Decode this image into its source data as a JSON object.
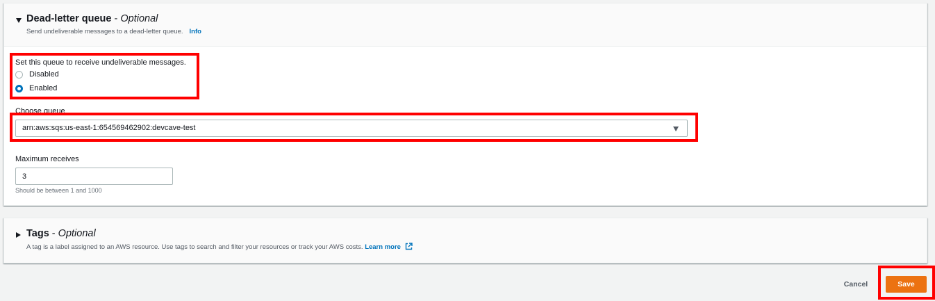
{
  "dlq_section": {
    "title": "Dead-letter queue",
    "separator": " - ",
    "optional": "Optional",
    "description": "Send undeliverable messages to a dead-letter queue.",
    "info_link": "Info",
    "receive_label": "Set this queue to receive undeliverable messages.",
    "options": [
      {
        "label": "Disabled",
        "checked": false
      },
      {
        "label": "Enabled",
        "checked": true
      }
    ],
    "choose_queue_label": "Choose queue",
    "queue_value": "arn:aws:sqs:us-east-1:654569462902:devcave-test",
    "max_receives_label": "Maximum receives",
    "max_receives_value": "3",
    "max_receives_hint": "Should be between 1 and 1000"
  },
  "tags_section": {
    "title": "Tags",
    "separator": " - ",
    "optional": "Optional",
    "description": "A tag is a label assigned to an AWS resource. Use tags to search and filter your resources or track your AWS costs.",
    "learn_more": "Learn more"
  },
  "footer": {
    "cancel_label": "Cancel",
    "save_label": "Save"
  },
  "icons": {
    "dlq_expand": "caret-down-icon",
    "tags_expand": "caret-right-icon",
    "queue_dropdown": "triangle-down-icon",
    "learn_more_external": "external-link-icon"
  },
  "colors": {
    "accent_orange": "#ec7211",
    "link_blue": "#0073bb",
    "annotation_red": "#ff0000",
    "page_bg": "#f2f3f3"
  }
}
